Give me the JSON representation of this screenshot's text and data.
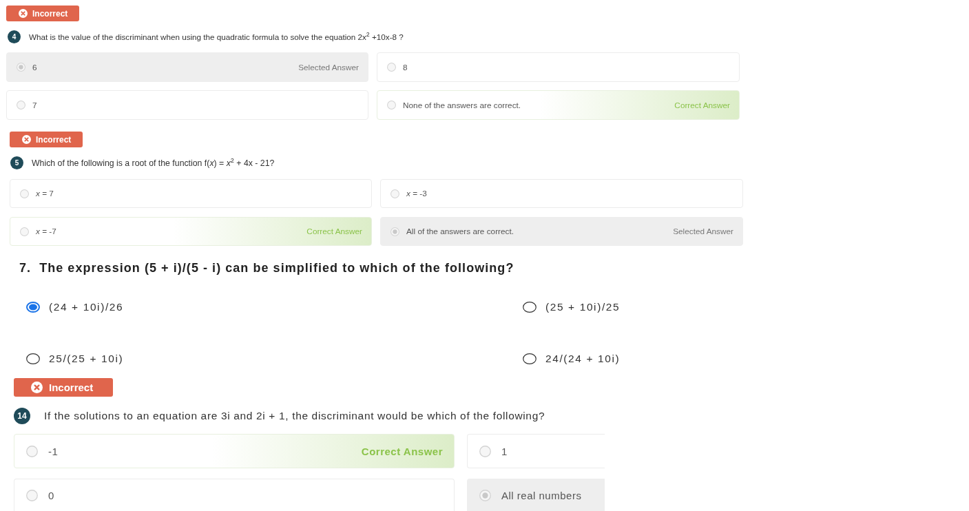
{
  "questions": [
    {
      "kind": "graded",
      "result": {
        "label": "Incorrect",
        "correct": false
      },
      "number": "4",
      "text": "What is the value of the discriminant when using the quadratic formula to solve the equation 2x$^{2}$ +10x-8 ?",
      "options": [
        {
          "text": "6",
          "selected": true,
          "correct": false,
          "tag": "Selected Answer"
        },
        {
          "text": "8",
          "selected": false,
          "correct": false
        },
        {
          "text": "7",
          "selected": false,
          "correct": false
        },
        {
          "text": "None of the answers are correct.",
          "selected": false,
          "correct": true,
          "tag": "Correct Answer"
        }
      ]
    },
    {
      "kind": "graded",
      "result": {
        "label": "Incorrect",
        "correct": false
      },
      "number": "5",
      "text": "Which of the following is a root of the function f(*x*) = *x*$^{2}$ + 4x - 21?",
      "options": [
        {
          "text": "*x* = 7",
          "selected": false,
          "correct": false
        },
        {
          "text": "*x* = -3",
          "selected": false,
          "correct": false
        },
        {
          "text": "*x* = -7",
          "selected": false,
          "correct": true,
          "tag": "Correct Answer"
        },
        {
          "text": "All of the answers are correct.",
          "selected": true,
          "correct": false,
          "tag": "Selected Answer"
        }
      ]
    },
    {
      "kind": "plain",
      "number": "7.",
      "text": "The expression (5 + i)/(5 - i) can be simplified to which of the following?",
      "options": [
        {
          "text": "(24 + 10i)/26",
          "selected": true
        },
        {
          "text": "(25 + 10i)/25",
          "selected": false
        },
        {
          "text": "25/(25 + 10i)",
          "selected": false
        },
        {
          "text": "24/(24 + 10i)",
          "selected": false
        }
      ]
    },
    {
      "kind": "graded",
      "result": {
        "label": "Incorrect",
        "correct": false
      },
      "number": "14",
      "text": "If the solutions to an equation are 3i and 2i + 1, the discriminant would be which of the following?",
      "options": [
        {
          "text": "-1",
          "selected": false,
          "correct": true,
          "tag": "Correct Answer"
        },
        {
          "text": "1",
          "selected": false,
          "correct": false
        },
        {
          "text": "0",
          "selected": false,
          "correct": false
        },
        {
          "text": "All real numbers",
          "selected": true,
          "correct": false
        }
      ]
    }
  ]
}
